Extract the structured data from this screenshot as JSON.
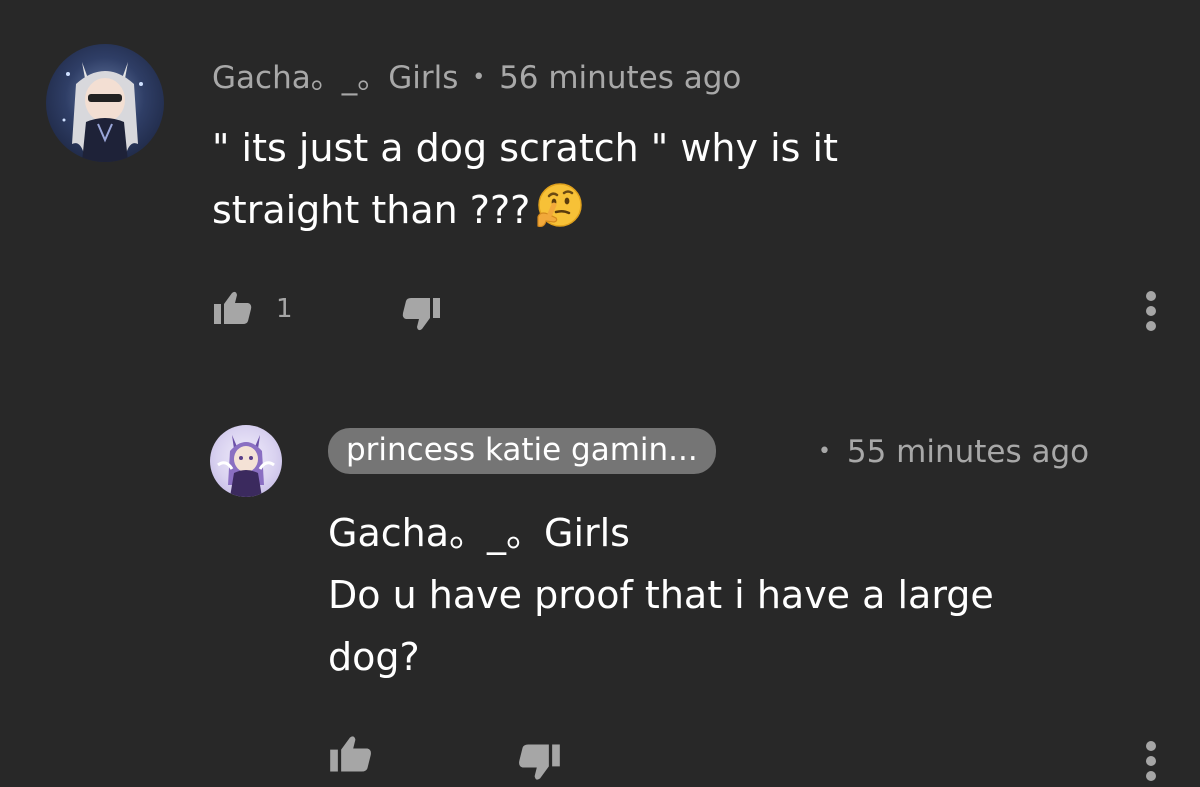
{
  "comment": {
    "author": "Gacha。_。Girls",
    "separator": "•",
    "time": "56 minutes ago",
    "text_line1": "\" its just a dog scratch \" why is it",
    "text_line2": "straight than ???",
    "emoji": "thinking-face",
    "like_count": "1",
    "icons": {
      "like": "thumbs-up-icon",
      "dislike": "thumbs-down-icon",
      "menu": "more-vertical-icon"
    }
  },
  "reply": {
    "author": "princess katie gamin...",
    "separator": "•",
    "time": "55 minutes ago",
    "mention": "Gacha。_。Girls",
    "text_line1": "Do u have proof that i have a large",
    "text_line2": "dog?",
    "icons": {
      "like": "thumbs-up-icon",
      "dislike": "thumbs-down-icon",
      "menu": "more-vertical-icon"
    }
  },
  "colors": {
    "background": "#282828",
    "meta_text": "#a8a8a8",
    "body_text": "#ffffff",
    "author_pill": "#757575",
    "icon": "#a6a6a6"
  }
}
